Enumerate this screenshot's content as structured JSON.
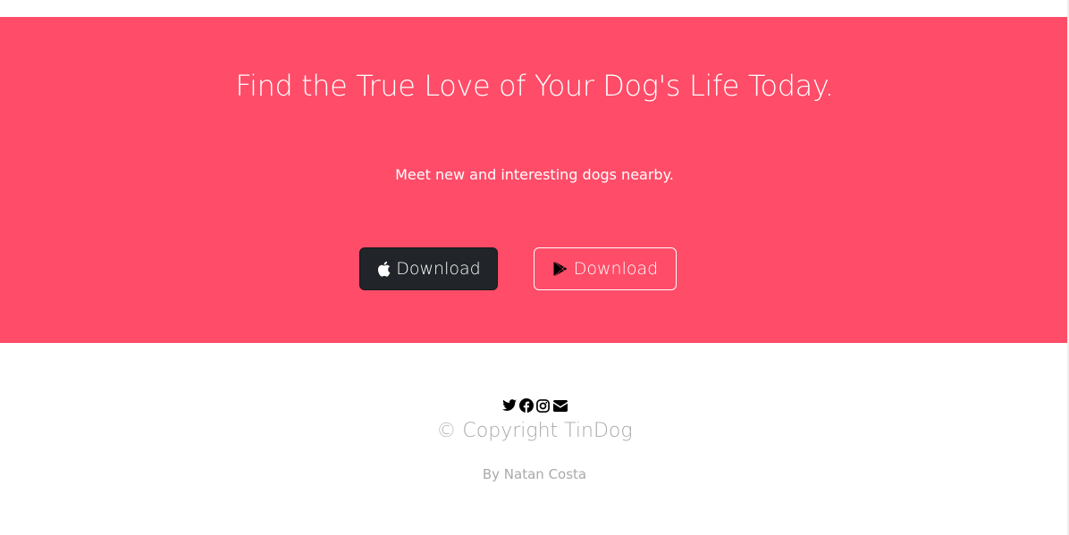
{
  "cta": {
    "heading": "Find the True Love of Your Dog's Life Today.",
    "subheading": "Meet new and interesting dogs nearby.",
    "apple_button_label": "Download",
    "play_button_label": "Download",
    "background_color": "#ff4c68"
  },
  "footer": {
    "icons": [
      "twitter-icon",
      "facebook-icon",
      "instagram-icon",
      "envelope-icon"
    ],
    "copyright": "© Copyright TinDog",
    "byline": "By Natan Costa"
  }
}
